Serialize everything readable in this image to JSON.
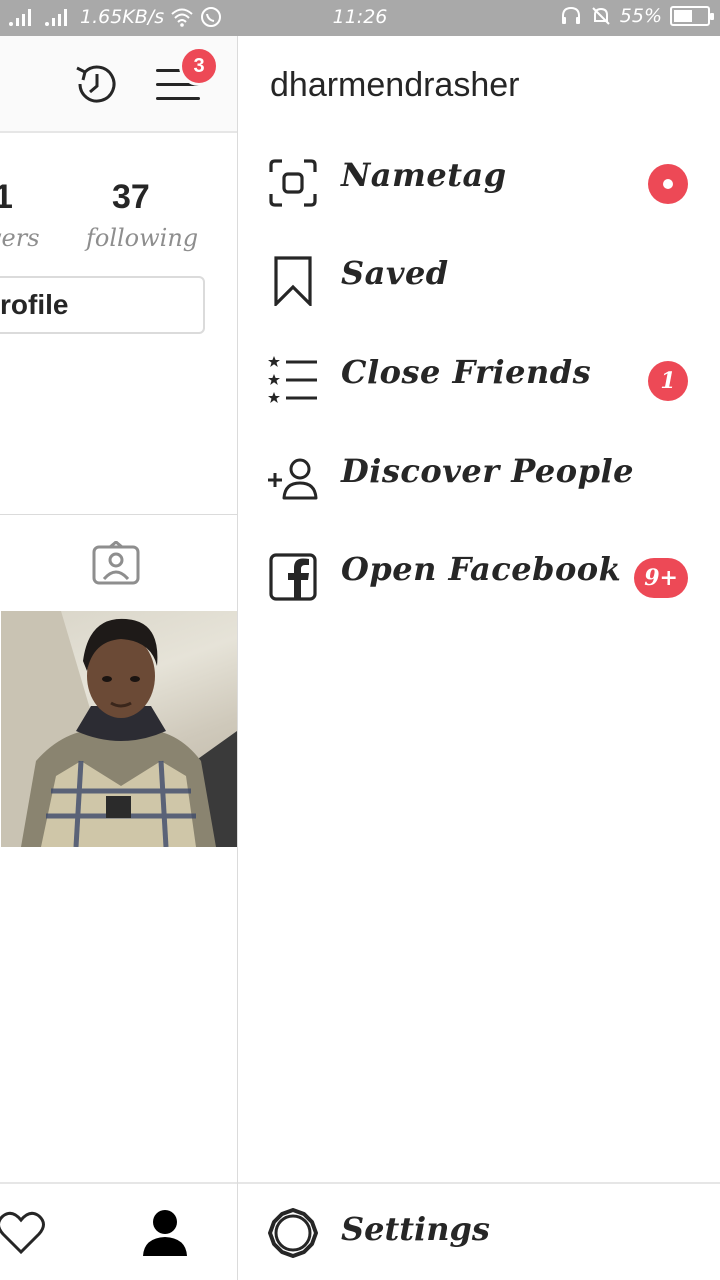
{
  "status_bar": {
    "network_speed": "1.65KB/s",
    "time": "11:26",
    "battery_percent": "55%",
    "battery_level": 0.55
  },
  "profile_panel": {
    "notification_count": "3",
    "stat_partial_value": "1",
    "stat_partial_label": "vers",
    "following_count": "37",
    "following_label": "following",
    "edit_profile_partial": "rofile"
  },
  "drawer": {
    "username": "dharmendrasher",
    "items": [
      {
        "label": "Nametag",
        "icon": "nametag-icon",
        "badge": ""
      },
      {
        "label": "Saved",
        "icon": "bookmark-icon",
        "badge": ""
      },
      {
        "label": "Close Friends",
        "icon": "close-friends-icon",
        "badge": "1"
      },
      {
        "label": "Discover People",
        "icon": "add-person-icon",
        "badge": ""
      },
      {
        "label": "Open Facebook",
        "icon": "facebook-icon",
        "badge": "9+"
      }
    ],
    "footer": {
      "label": "Settings",
      "icon": "settings-icon"
    }
  },
  "colors": {
    "badge_red": "#ed4956",
    "status_bar_gray": "#a9a9a9",
    "text_dark": "#262626",
    "text_muted": "#8e8e8e"
  }
}
